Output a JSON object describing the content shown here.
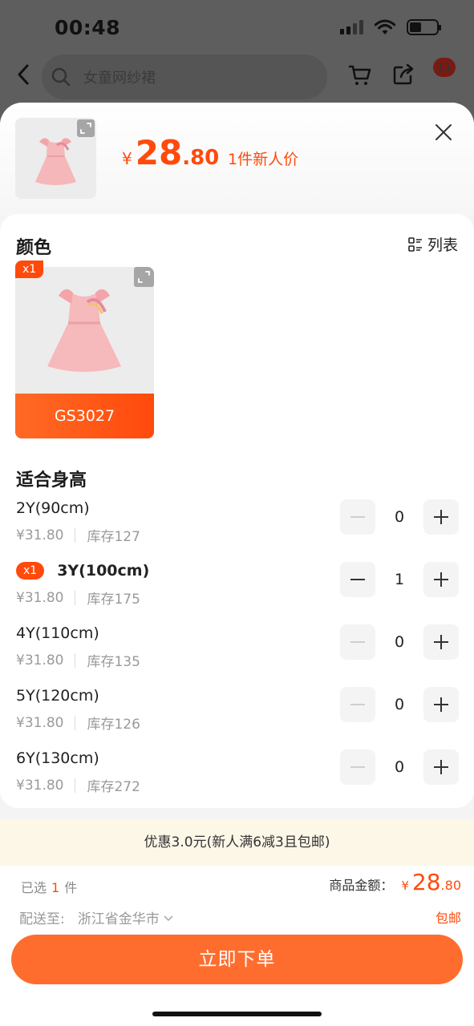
{
  "status_bar": {
    "time": "00:48"
  },
  "nav": {
    "search_placeholder": "女童网纱裙",
    "message_count": "11"
  },
  "header": {
    "currency": "¥",
    "price_int": "28",
    "price_dec": ".80",
    "price_note": "1件新人价"
  },
  "color_section": {
    "title": "颜色",
    "view_toggle": "列表",
    "options": [
      {
        "label": "GS3027",
        "qty_tag": "x1"
      }
    ]
  },
  "size_section": {
    "title": "适合身高",
    "rows": [
      {
        "size": "2Y(90cm)",
        "price": "¥31.80",
        "stock": "库存127",
        "qty": "0",
        "tag": ""
      },
      {
        "size": "3Y(100cm)",
        "price": "¥31.80",
        "stock": "库存175",
        "qty": "1",
        "tag": "x1"
      },
      {
        "size": "4Y(110cm)",
        "price": "¥31.80",
        "stock": "库存135",
        "qty": "0",
        "tag": ""
      },
      {
        "size": "5Y(120cm)",
        "price": "¥31.80",
        "stock": "库存126",
        "qty": "0",
        "tag": ""
      },
      {
        "size": "6Y(130cm)",
        "price": "¥31.80",
        "stock": "库存272",
        "qty": "0",
        "tag": ""
      }
    ]
  },
  "promo": {
    "text": "优惠3.0元(新人满6减3且包邮)"
  },
  "footer": {
    "selected_prefix": "已选",
    "selected_count": "1",
    "selected_suffix": "件",
    "total_label": "商品金额：",
    "total_currency": "¥",
    "total_int": "28",
    "total_dec": ".80",
    "ship_label": "配送至:",
    "ship_to": "浙江省金华市",
    "free_shipping": "包邮",
    "buy_button": "立即下单"
  },
  "colors": {
    "accent": "#ff4a0c",
    "button": "#ff6d2e",
    "promo_bg": "#fdf7e8"
  }
}
